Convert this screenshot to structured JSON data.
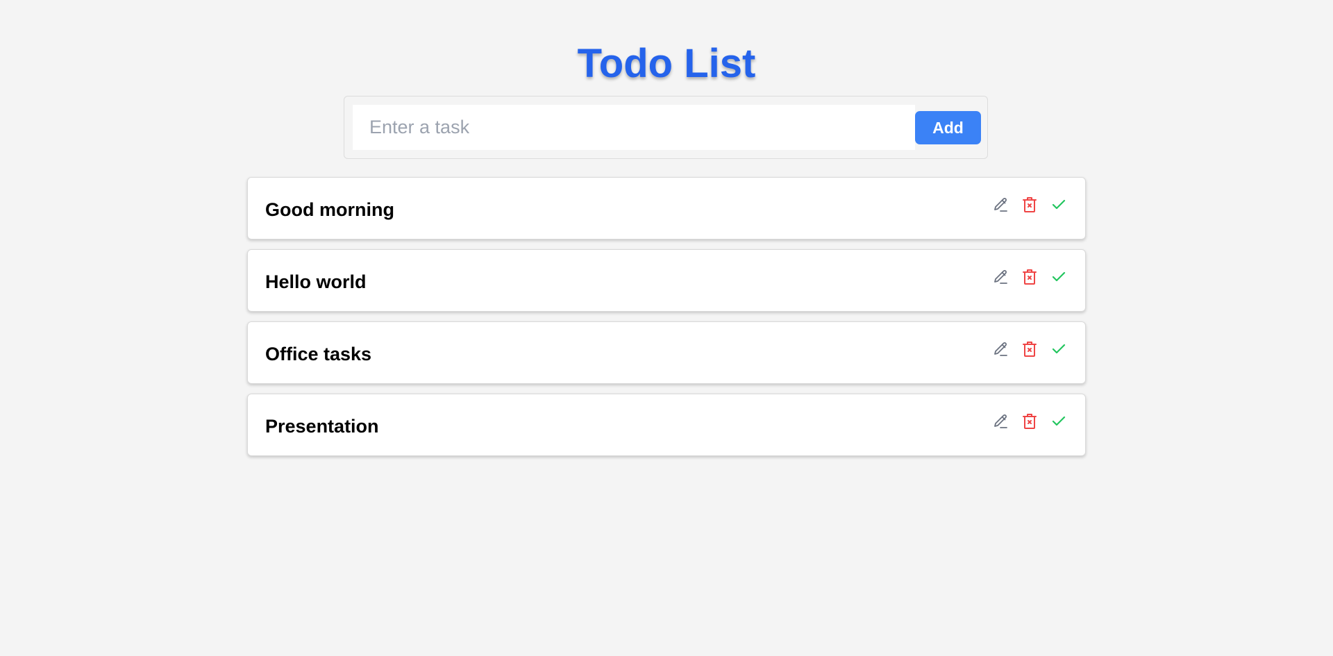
{
  "app": {
    "title": "Todo List"
  },
  "form": {
    "input_value": "",
    "placeholder": "Enter a task",
    "add_label": "Add"
  },
  "todos": [
    {
      "text": "Good morning"
    },
    {
      "text": "Hello world"
    },
    {
      "text": "Office tasks"
    },
    {
      "text": "Presentation"
    }
  ],
  "icons": {
    "edit": "pencil-icon",
    "delete": "trash-icon",
    "complete": "check-icon"
  },
  "colors": {
    "title": "#2563eb",
    "button": "#3b82f6",
    "edit": "#6b7280",
    "delete": "#ef4444",
    "complete": "#22c55e"
  }
}
